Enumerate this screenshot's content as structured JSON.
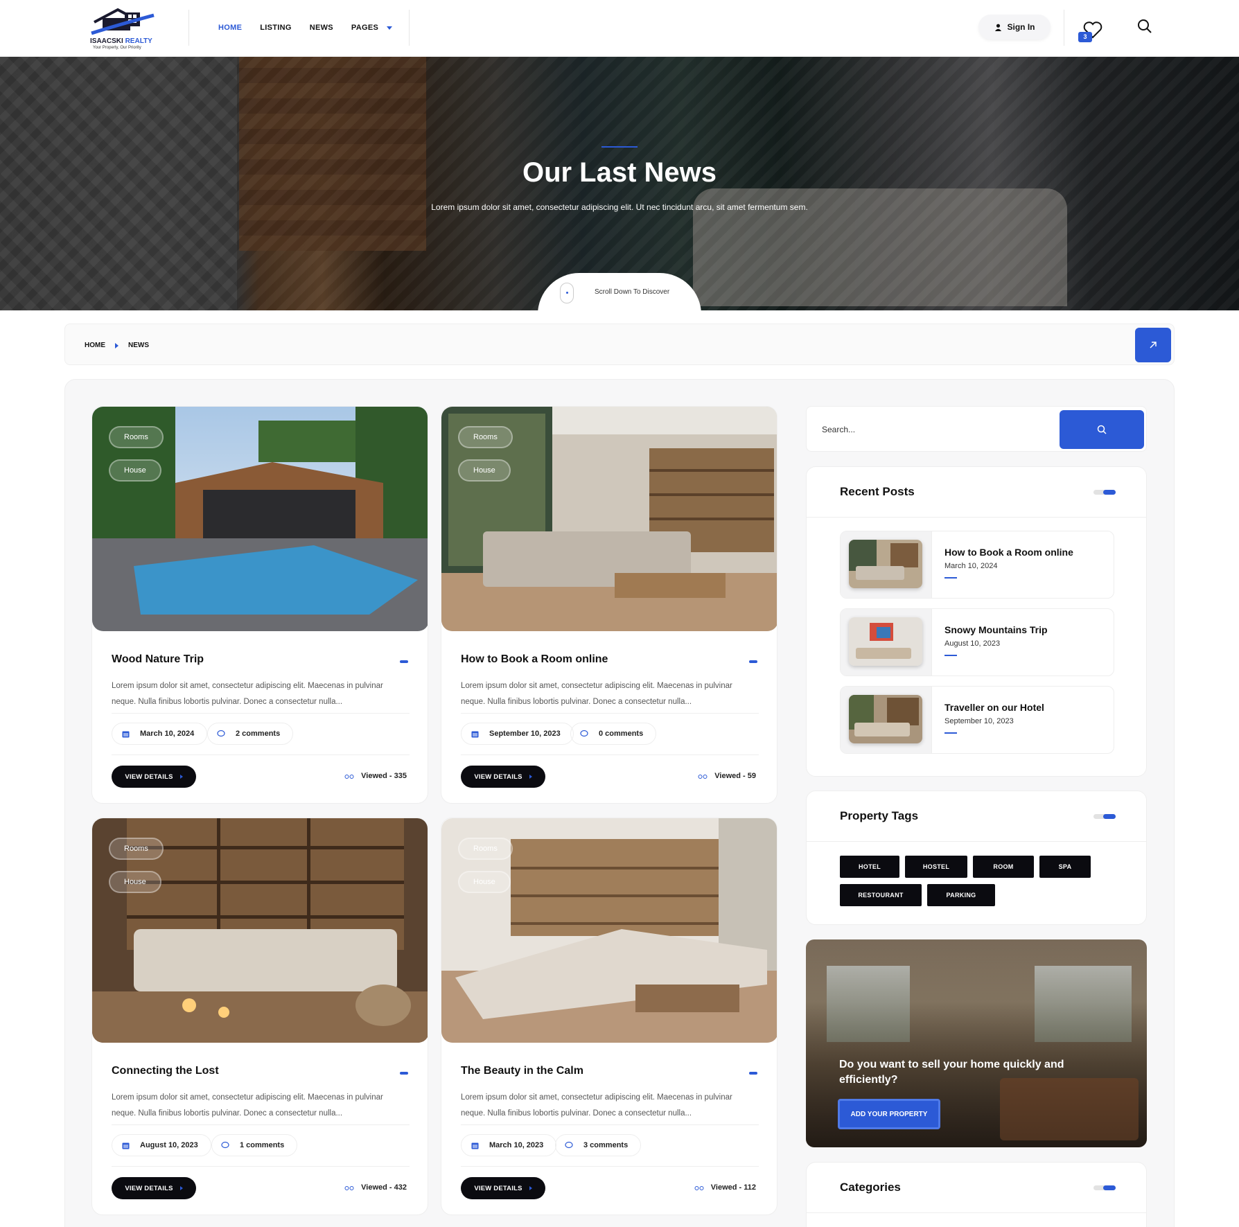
{
  "header": {
    "logo_name": "ISAACSKI",
    "logo_name_accent": "REALTY",
    "logo_tagline": "Your Property, Our Priority",
    "nav": [
      {
        "label": "HOME"
      },
      {
        "label": "LISTING"
      },
      {
        "label": "NEWS"
      },
      {
        "label": "PAGES"
      }
    ],
    "signin_label": "Sign In",
    "wishlist_count": "3",
    "accent_color": "#2c5ad6"
  },
  "hero": {
    "title": "Our Last News",
    "subtitle": "Lorem ipsum dolor sit amet, consectetur adipiscing elit. Ut nec tincidunt arcu, sit amet fermentum sem.",
    "scroll_label": "Scroll Down To Discover"
  },
  "breadcrumb": {
    "items": [
      "HOME",
      "NEWS"
    ]
  },
  "posts": [
    {
      "tags": [
        "Rooms",
        "House"
      ],
      "title": "Wood Nature Trip",
      "excerpt": "Lorem ipsum dolor sit amet, consectetur adipiscing elit. Maecenas in pulvinar neque. Nulla finibus lobortis pulvinar. Donec a consectetur nulla...",
      "date": "March 10, 2024",
      "comments": "2 comments",
      "button": "VIEW DETAILS",
      "viewed": "Viewed - 335"
    },
    {
      "tags": [
        "Rooms",
        "House"
      ],
      "title": "How to Book a Room online",
      "excerpt": "Lorem ipsum dolor sit amet, consectetur adipiscing elit. Maecenas in pulvinar neque. Nulla finibus lobortis pulvinar. Donec a consectetur nulla...",
      "date": "September 10, 2023",
      "comments": "0 comments",
      "button": "VIEW DETAILS",
      "viewed": "Viewed - 59"
    },
    {
      "tags": [
        "Rooms",
        "House"
      ],
      "title": "Connecting the Lost",
      "excerpt": "Lorem ipsum dolor sit amet, consectetur adipiscing elit. Maecenas in pulvinar neque. Nulla finibus lobortis pulvinar. Donec a consectetur nulla...",
      "date": "August 10, 2023",
      "comments": "1 comments",
      "button": "VIEW DETAILS",
      "viewed": "Viewed - 432"
    },
    {
      "tags": [
        "Rooms",
        "House"
      ],
      "title": "The Beauty in the Calm",
      "excerpt": "Lorem ipsum dolor sit amet, consectetur adipiscing elit. Maecenas in pulvinar neque. Nulla finibus lobortis pulvinar. Donec a consectetur nulla...",
      "date": "March 10, 2023",
      "comments": "3 comments",
      "button": "VIEW DETAILS",
      "viewed": "Viewed - 112"
    }
  ],
  "sidebar": {
    "search_placeholder": "Search...",
    "recent_title": "Recent Posts",
    "recent": [
      {
        "title": "How to Book a Room online",
        "date": "March 10, 2024"
      },
      {
        "title": "Snowy Mountains Trip",
        "date": "August 10, 2023"
      },
      {
        "title": "Traveller on our Hotel",
        "date": "September 10, 2023"
      }
    ],
    "tags_title": "Property Tags",
    "tags": [
      "HOTEL",
      "HOSTEL",
      "ROOM",
      "SPA",
      "RESTOURANT",
      "PARKING"
    ],
    "promo_text": "Do you want to sell your home quickly and efficiently?",
    "promo_button": "ADD YOUR PROPERTY",
    "categories_title": "Categories"
  }
}
